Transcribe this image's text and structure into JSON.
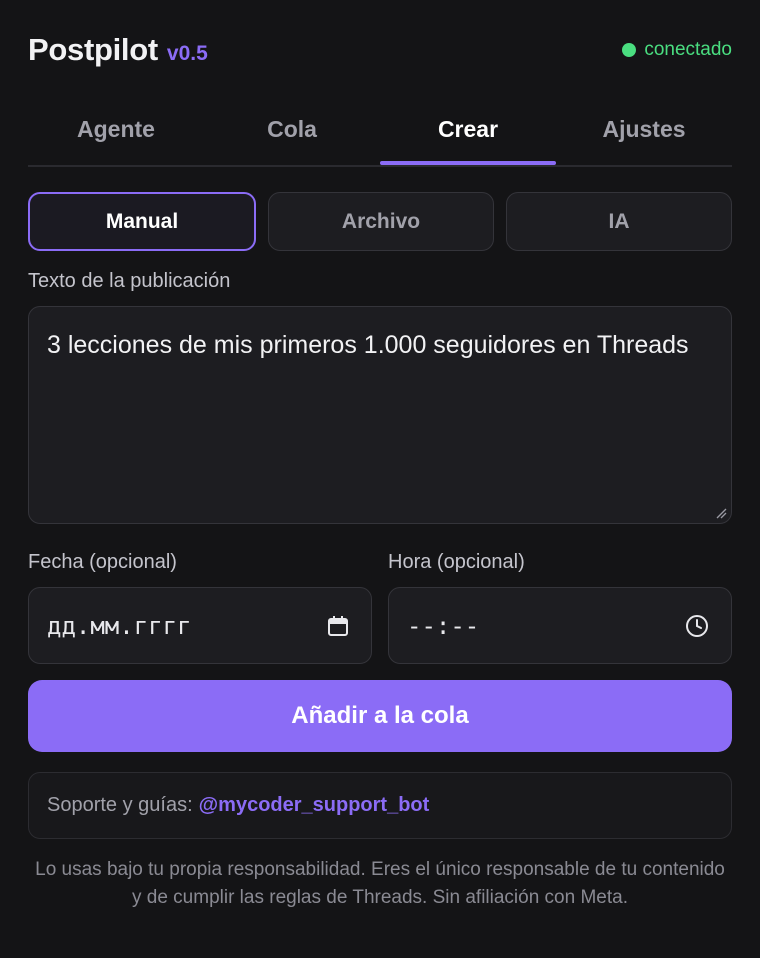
{
  "header": {
    "app_name": "Postpilot",
    "version": "v0.5",
    "status": "conectado",
    "status_color": "#4ade80"
  },
  "tabs": [
    {
      "label": "Agente",
      "active": false
    },
    {
      "label": "Cola",
      "active": false
    },
    {
      "label": "Crear",
      "active": true
    },
    {
      "label": "Ajustes",
      "active": false
    }
  ],
  "modes": [
    {
      "label": "Manual",
      "active": true
    },
    {
      "label": "Archivo",
      "active": false
    },
    {
      "label": "IA",
      "active": false
    }
  ],
  "post_text": {
    "label": "Texto de la publicación",
    "value": "3 lecciones de mis primeros 1.000 seguidores en Threads"
  },
  "date_field": {
    "label": "Fecha (opcional)",
    "value": "дд.мм.гггг",
    "icon": "calendar-icon"
  },
  "time_field": {
    "label": "Hora (opcional)",
    "value": "--:--",
    "icon": "clock-icon"
  },
  "actions": {
    "add_to_queue": "Añadir a la cola"
  },
  "support": {
    "prefix": "Soporte y guías:",
    "link": "@mycoder_support_bot"
  },
  "disclaimer": "Lo usas bajo tu propia responsabilidad. Eres el único responsable de tu contenido y de cumplir las reglas de Threads. Sin afiliación con Meta.",
  "colors": {
    "accent": "#8b6cf6",
    "background": "#141416",
    "surface": "#1d1d21"
  }
}
